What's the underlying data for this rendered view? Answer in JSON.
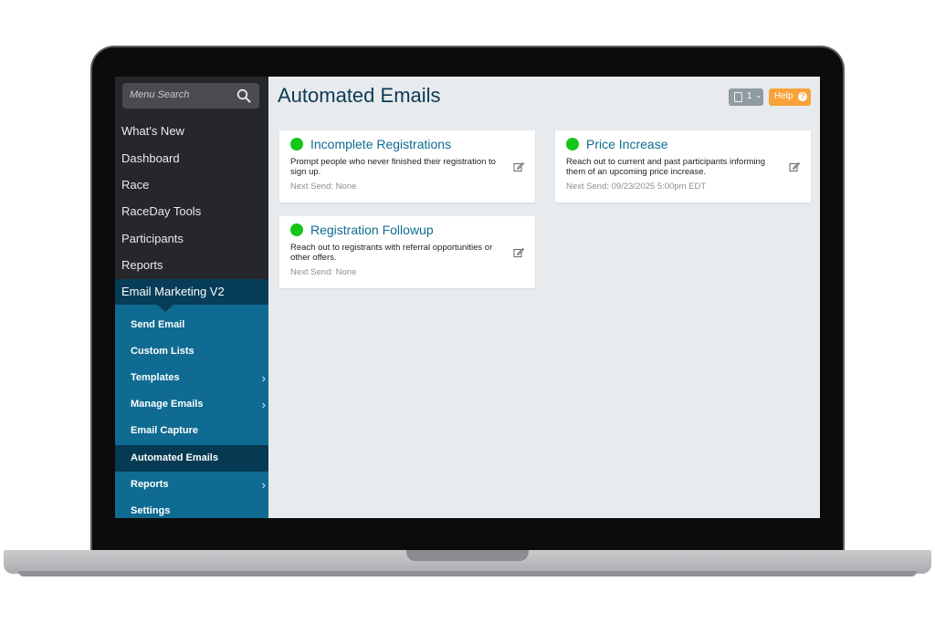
{
  "sidebar": {
    "search_placeholder": "Menu Search",
    "items": [
      {
        "label": "What's New"
      },
      {
        "label": "Dashboard"
      },
      {
        "label": "Race"
      },
      {
        "label": "RaceDay Tools"
      },
      {
        "label": "Participants"
      },
      {
        "label": "Reports"
      }
    ],
    "active_section": "Email Marketing V2",
    "submenu": [
      {
        "label": "Send Email"
      },
      {
        "label": "Custom Lists"
      },
      {
        "label": "Templates"
      },
      {
        "label": "Manage Emails"
      },
      {
        "label": "Email Capture"
      },
      {
        "label": "Automated Emails"
      },
      {
        "label": "Reports"
      },
      {
        "label": "Settings"
      }
    ]
  },
  "header": {
    "title": "Automated Emails",
    "doc_count": "1",
    "help_label": "Help"
  },
  "cards": [
    {
      "title": "Incomplete Registrations",
      "description": "Prompt people who never finished their registration to sign up.",
      "next_send": "Next Send: None",
      "status_color": "#15c61b"
    },
    {
      "title": "Price Increase",
      "description": "Reach out to current and past participants informing them of an upcoming price increase.",
      "next_send": "Next Send: 09/23/2025 5:00pm EDT",
      "status_color": "#15c61b"
    },
    {
      "title": "Registration Followup",
      "description": "Reach out to registrants with referral opportunities or other offers.",
      "next_send": "Next Send: None",
      "status_color": "#15c61b"
    }
  ],
  "colors": {
    "sidebar_bg": "#26272b",
    "active_section_bg": "#073d57",
    "submenu_bg": "#0f6b91",
    "accent_orange": "#f7a23b",
    "status_green": "#15c61b"
  }
}
